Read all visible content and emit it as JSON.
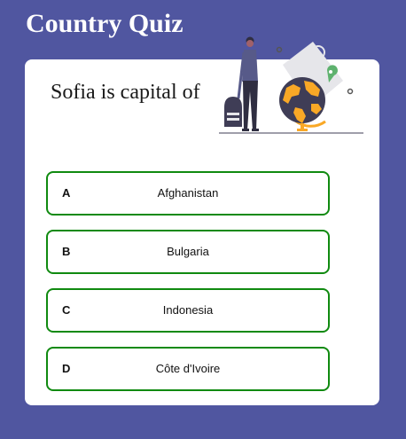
{
  "app": {
    "title": "Country Quiz"
  },
  "question": {
    "text": "Sofia is capital of"
  },
  "options": [
    {
      "letter": "A",
      "text": "Afghanistan"
    },
    {
      "letter": "B",
      "text": "Bulgaria"
    },
    {
      "letter": "C",
      "text": "Indonesia"
    },
    {
      "letter": "D",
      "text": "Côte d'Ivoire"
    }
  ],
  "theme": {
    "background": "#5056a0",
    "card": "#ffffff",
    "option_border": "#108a10",
    "accent": "#f9a826"
  },
  "illustration": {
    "icon": "traveler-with-globe-illustration"
  }
}
